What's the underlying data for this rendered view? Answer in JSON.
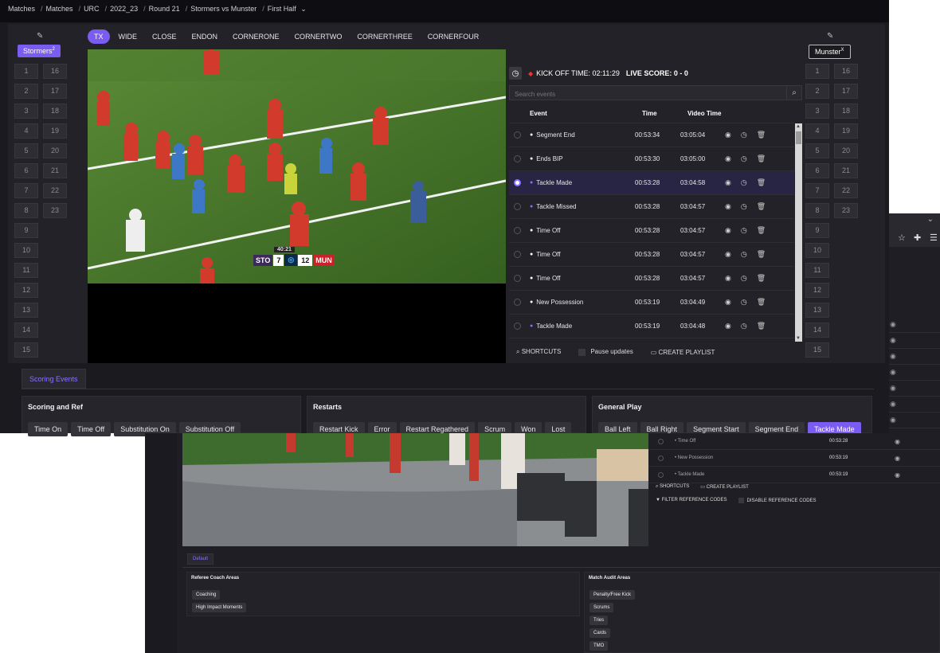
{
  "breadcrumb": [
    "Matches",
    "Matches",
    "URC",
    "2022_23",
    "Round 21",
    "Stormers vs Munster",
    "First Half"
  ],
  "teams": {
    "home": {
      "name": "Stormers",
      "badge": "2"
    },
    "away": {
      "name": "Munster",
      "badge": "X"
    }
  },
  "numbers": {
    "col1": [
      "1",
      "2",
      "3",
      "4",
      "5",
      "6",
      "7",
      "8",
      "9",
      "10",
      "11",
      "12",
      "13",
      "14",
      "15"
    ],
    "col2": [
      "16",
      "17",
      "18",
      "19",
      "20",
      "21",
      "22",
      "23"
    ]
  },
  "angles": [
    "TX",
    "WIDE",
    "CLOSE",
    "ENDON",
    "CORNERONE",
    "CORNERTWO",
    "CORNERTHREE",
    "CORNERFOUR"
  ],
  "active_angle": "TX",
  "scoreboard": {
    "clock": "40:21",
    "home": "STO",
    "home_score": "7",
    "away_score": "12",
    "away": "MUN"
  },
  "events_panel": {
    "kickoff_label": "KICK OFF TIME: 02:11:29",
    "live_score": "LIVE SCORE: 0 - 0",
    "search_placeholder": "Search events",
    "columns": [
      "Event",
      "Time",
      "Video Time"
    ],
    "rows": [
      {
        "event": "Segment End",
        "time": "00:53:34",
        "video_time": "03:05:04",
        "selected": false,
        "purple": false
      },
      {
        "event": "Ends BIP",
        "time": "00:53:30",
        "video_time": "03:05:00",
        "selected": false,
        "purple": false
      },
      {
        "event": "Tackle Made",
        "time": "00:53:28",
        "video_time": "03:04:58",
        "selected": true,
        "purple": true
      },
      {
        "event": "Tackle Missed",
        "time": "00:53:28",
        "video_time": "03:04:57",
        "selected": false,
        "purple": true
      },
      {
        "event": "Time Off",
        "time": "00:53:28",
        "video_time": "03:04:57",
        "selected": false,
        "purple": false
      },
      {
        "event": "Time Off",
        "time": "00:53:28",
        "video_time": "03:04:57",
        "selected": false,
        "purple": false
      },
      {
        "event": "Time Off",
        "time": "00:53:28",
        "video_time": "03:04:57",
        "selected": false,
        "purple": false
      },
      {
        "event": "New Possession",
        "time": "00:53:19",
        "video_time": "03:04:49",
        "selected": false,
        "purple": false
      },
      {
        "event": "Tackle Made",
        "time": "00:53:19",
        "video_time": "03:04:48",
        "selected": false,
        "purple": true
      }
    ],
    "shortcuts": "SHORTCUTS",
    "pause_updates": "Pause updates",
    "create_playlist": "CREATE PLAYLIST"
  },
  "scoring_tab": "Scoring Events",
  "sections": [
    {
      "title": "Scoring and Ref",
      "buttons": [
        "Time On",
        "Time Off",
        "Substitution On",
        "Substitution Off"
      ]
    },
    {
      "title": "Restarts",
      "buttons": [
        "Restart Kick",
        "Error",
        "Restart Regathered",
        "Scrum",
        "Won",
        "Lost"
      ]
    },
    {
      "title": "General Play",
      "buttons": [
        "Ball Left",
        "Ball Right",
        "Segment Start",
        "Segment End",
        "Tackle Made"
      ]
    }
  ],
  "active_general_button": "Tackle Made",
  "overlay": {
    "list": [
      {
        "event": "Time Off",
        "time": "00:53:28"
      },
      {
        "event": "New Possession",
        "time": "00:53:19"
      },
      {
        "event": "Tackle Made",
        "time": "00:53:19"
      }
    ],
    "shortcuts": "SHORTCUTS",
    "create_playlist": "CREATE PLAYLIST",
    "filter_codes": "FILTER REFERENCE CODES",
    "disable_codes": "DISABLE REFERENCE CODES",
    "default_tab": "Default",
    "referee_title": "Referee Coach Areas",
    "referee_buttons": [
      "Coaching",
      "High Impact Moments"
    ],
    "audit_title": "Match Audit Areas",
    "audit_buttons": [
      "Penalty/Free Kick",
      "Scrums",
      "Tries",
      "Cards",
      "TMO"
    ]
  },
  "colors": {
    "accent": "#7b5cf0",
    "bg": "#1b1a1f",
    "panel": "#232228",
    "pitch": "#3f6a2a"
  },
  "icons": [
    "edit-icon",
    "clock-icon",
    "search-icon",
    "eye-icon",
    "history-icon",
    "trash-icon",
    "shortcuts-icon",
    "playlist-icon",
    "star-icon",
    "puzzle-icon",
    "menu-icon",
    "chevron-down-icon"
  ]
}
